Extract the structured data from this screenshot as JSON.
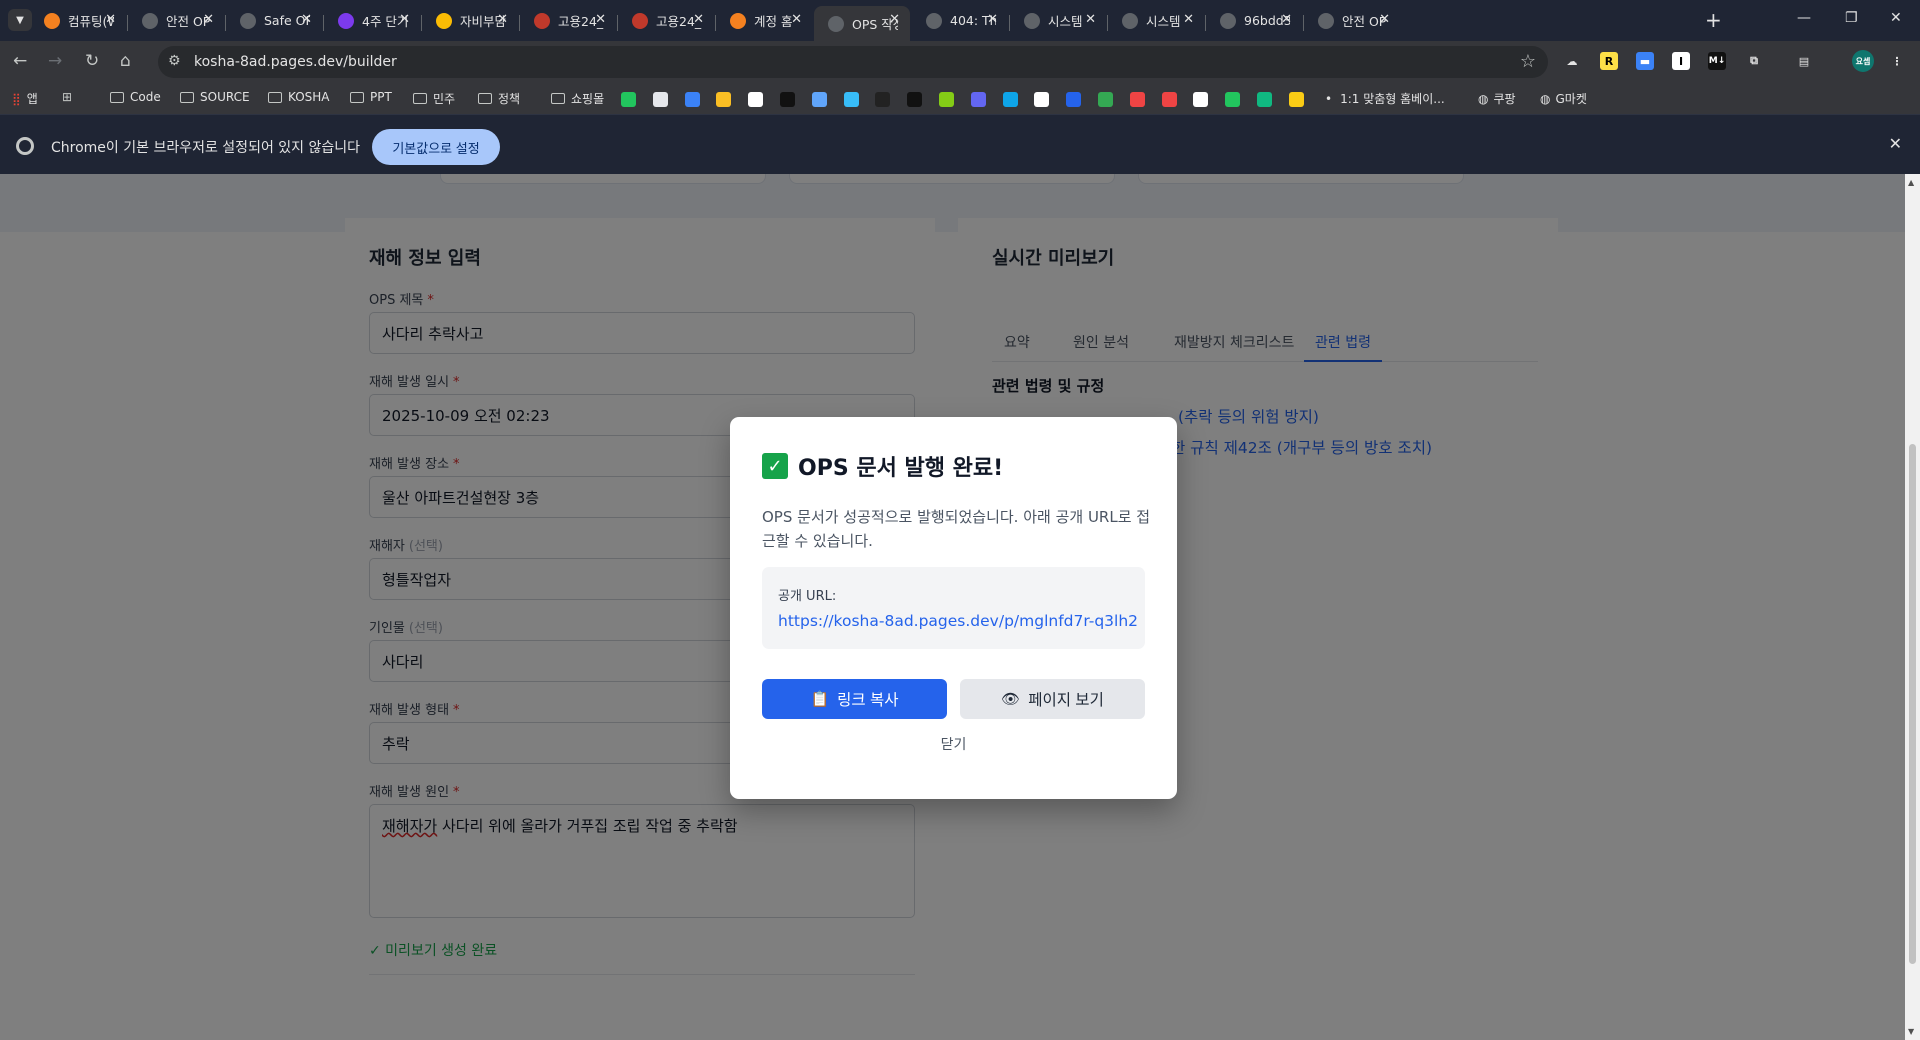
{
  "browser": {
    "tabs": [
      {
        "title": "컴퓨팅(W",
        "fav_color": "#f48120"
      },
      {
        "title": "안전 OP",
        "fav_color": "#5f6368"
      },
      {
        "title": "Safe OP",
        "fav_color": "#5f6368"
      },
      {
        "title": "4주 단기",
        "fav_color": "#7c3aed"
      },
      {
        "title": "자비부담",
        "fav_color": "#fbbc04"
      },
      {
        "title": "고용24_",
        "fav_color": "#c0392b"
      },
      {
        "title": "고용24_",
        "fav_color": "#c0392b"
      },
      {
        "title": "계정 홈",
        "fav_color": "#f48120"
      },
      {
        "title": "OPS 작성",
        "fav_color": "#5f6368"
      },
      {
        "title": "404: Thi",
        "fav_color": "#5f6368"
      },
      {
        "title": "시스템 ",
        "fav_color": "#5f6368"
      },
      {
        "title": "시스템 ",
        "fav_color": "#5f6368"
      },
      {
        "title": "96bdd3",
        "fav_color": "#5f6368"
      },
      {
        "title": "안전 OP",
        "fav_color": "#5f6368"
      }
    ],
    "active_tab_index": 8,
    "url": "kosha-8ad.pages.dev/builder",
    "profile_label": "요셉",
    "bookmarks": {
      "apps": "앱",
      "folders": [
        "Code",
        "SOURCE",
        "KOSHA",
        "PPT",
        "민주",
        "정책",
        "쇼핑몰"
      ],
      "items": [
        "1:1 맞춤형 홈베이...",
        "쿠팡",
        "G마켓"
      ]
    },
    "infobar": {
      "message": "Chrome이 기본 브라우저로 설정되어 있지 않습니다",
      "button": "기본값으로 설정"
    }
  },
  "form": {
    "title": "재해 정보 입력",
    "fields": [
      {
        "label": "OPS 제목",
        "required": true,
        "value": "사다리 추락사고"
      },
      {
        "label": "재해 발생 일시",
        "required": true,
        "value": "2025-10-09 오전 02:23"
      },
      {
        "label": "재해 발생 장소",
        "required": true,
        "value": "울산 아파트건설현장 3층"
      },
      {
        "label": "재해자",
        "optional": "(선택)",
        "value": "형틀작업자"
      },
      {
        "label": "기인물",
        "optional": "(선택)",
        "value": "사다리"
      },
      {
        "label": "재해 발생 형태",
        "required": true,
        "value": "추락"
      },
      {
        "label": "재해 발생 원인",
        "required": true,
        "value_first": "재해자가",
        "value_rest": " 사다리 위에 올라가 거푸집 조립 작업 중 추락함"
      }
    ],
    "required_mark": "*",
    "status": "✓ 미리보기 생성 완료"
  },
  "preview": {
    "title": "실시간 미리보기",
    "tabs": [
      "요약",
      "원인 분석",
      "재발방지 체크리스트",
      "관련 법령"
    ],
    "active_tab": 3,
    "section_title": "관련 법령 및 규정",
    "laws": [
      "(추락 등의 위험 방지)",
      "한 규칙 제42조 (개구부 등의 방호 조치)"
    ]
  },
  "modal": {
    "title": "OPS 문서 발행 완료!",
    "description": "OPS 문서가 성공적으로 발행되었습니다. 아래 공개 URL로 접근할 수 있습니다.",
    "url_label": "공개 URL:",
    "public_url": "https://kosha-8ad.pages.dev/p/mglnfd7r-q3lh2",
    "copy_button": "링크 복사",
    "view_button": "페이지 보기",
    "close_text": "닫기"
  },
  "colors": {
    "accent": "#2563eb",
    "success": "#16a34a",
    "required": "#dc2626"
  }
}
